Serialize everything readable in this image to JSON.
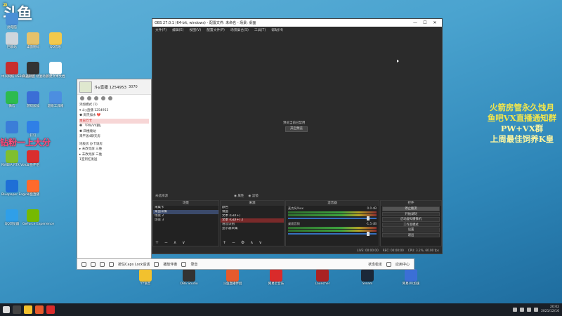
{
  "desktop": {
    "logo": "斗鱼",
    "logo_prefix": "20",
    "icons": [
      {
        "label": "此电脑",
        "color": "#4a8fd6"
      },
      {
        "label": "回收站",
        "color": "#cfd6dc"
      },
      {
        "label": "桌面图标",
        "color": "#e6c26b"
      },
      {
        "label": "QQ音乐",
        "color": "#f2c94c"
      },
      {
        "label": "中兴网络 USBKey管理",
        "color": "#c72e2e"
      },
      {
        "label": "英雄联盟 修复助手",
        "color": "#333333"
      },
      {
        "label": "新建文本文档",
        "color": "#ffffff"
      },
      {
        "label": "微信",
        "color": "#2dbb4e"
      },
      {
        "label": "游戏加加",
        "color": "#3b6ed6"
      },
      {
        "label": "超级工具箱",
        "color": "#4c8ee0"
      },
      {
        "label": "",
        "color": "#3b7dd8"
      },
      {
        "label": "钉钉",
        "color": "#2f7fe6"
      },
      {
        "label": "NVIDIA RTX Voice",
        "color": "#7fbf2e"
      },
      {
        "label": "斗鱼伴侣",
        "color": "#d92e2e"
      },
      {
        "label": "Bluepaper Engine",
        "color": "#1f6fd6"
      },
      {
        "label": "斗鱼直播",
        "color": "#ff6a2c"
      },
      {
        "label": "QQ浏览器",
        "color": "#2f9fe8"
      },
      {
        "label": "GeForce Experience",
        "color": "#76b900"
      },
      {
        "label": "YY语音",
        "color": "#f2c12e"
      },
      {
        "label": "OBS Studio",
        "color": "#333333"
      },
      {
        "label": "斗鱼直播伴侣",
        "color": "#e65a2c"
      },
      {
        "label": "网易云音乐",
        "color": "#d92b2b"
      },
      {
        "label": "Launcher",
        "color": "#aa2222"
      },
      {
        "label": "Steam",
        "color": "#1b2838"
      },
      {
        "label": "网易UU加速",
        "color": "#3b6fd6"
      }
    ],
    "overlay_lines": [
      "火箭房管永久蚀月",
      "鱼吧VX直播通知群",
      "PW+VX群",
      "上周最佳饲养K皇"
    ],
    "float_text": "钻粉一上大分"
  },
  "douyu_client": {
    "streamer": "斗y直播 1254953",
    "room_id": "3070",
    "rows": [
      {
        "text": "添加模式 (1)",
        "sel": false
      },
      {
        "text": "▾ 斗y直播  1254953",
        "sel": false
      },
      {
        "text": "  ❶ 周杰加水 💔",
        "sel": false
      },
      {
        "text": "     本日万卡",
        "sel": true
      },
      {
        "text": "   ❷ 「PW/VX群」",
        "sel": false
      },
      {
        "text": "   ❸ 四楼顺动",
        "sel": false
      },
      {
        "text": "   来平饭4聊天房",
        "sel": false
      },
      {
        "text": "     地板房          办卡请房",
        "sel": false,
        "gap": true
      },
      {
        "text": "   ▸ 未改亮屏 三维",
        "sel": false
      },
      {
        "text": "   ▸ 未改亮屏 三维",
        "sel": false
      },
      {
        "text": "     1室到红发送",
        "sel": false
      }
    ]
  },
  "obs": {
    "title": "OBS 27.0.1 (64-bit, windows) - 配置文件: 未命名 - 场景: 桌面",
    "menu": [
      "文件(F)",
      "编辑(E)",
      "视图(V)",
      "配置文件(P)",
      "场景集合(S)",
      "工具(T)",
      "帮助(H)"
    ],
    "preview_msg": "预览当前已禁用",
    "preview_button": "开启预览",
    "source_bar_left": "未选择源",
    "source_bar_mid": [
      "◉ 属性",
      "◉ 滤镜"
    ],
    "docks": {
      "scenes": {
        "title": "场景",
        "items": [
          "采集卡",
          "桌面采集",
          "场景 2",
          "场景 3"
        ],
        "selected": 1
      },
      "sources": {
        "title": "来源",
        "items": [
          "颜色",
          "镜面",
          "文本 (GDI+)",
          "文本 (GDI+) 2",
          "语音识别",
          "显示器采集"
        ],
        "highlighted": 3
      },
      "mixer": {
        "title": "混音器",
        "channels": [
          {
            "name": "麦克风/Aux",
            "db": "0.0 dB"
          },
          {
            "name": "桌面音频",
            "db": "-1.5 dB"
          }
        ]
      },
      "controls": {
        "title": "控件",
        "buttons": [
          "停止推流",
          "开始录制",
          "启动虚拟摄像机",
          "工作室模式",
          "设置",
          "退出"
        ],
        "active": 0
      }
    },
    "status": [
      "LIVE: 00:00:00",
      "REC: 00:00:00",
      "CPU: 3.2%, 60.00 fps"
    ]
  },
  "douyu_bar": {
    "items": [
      "按住Caps Lock说话",
      "播放伴奏",
      "录音"
    ],
    "right": [
      "状态稳定",
      "应用中心"
    ]
  },
  "taskbar": {
    "time": "20:02",
    "date": "2021/12/16"
  }
}
